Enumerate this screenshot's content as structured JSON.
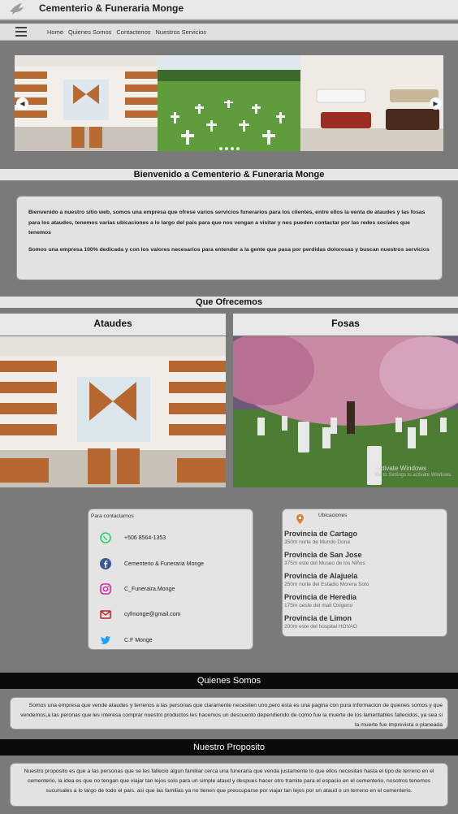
{
  "header": {
    "brand": "Cementerio & Funeraria Monge",
    "logo_icon": "dove-icon"
  },
  "nav": {
    "menu_icon": "hamburger-icon",
    "links": [
      "Home",
      "Quienes Somos",
      "Contactenos",
      "Nuestros Servicios"
    ]
  },
  "carousel": {
    "prev_icon": "chevron-left-icon",
    "next_icon": "chevron-right-icon",
    "slide_count": 4,
    "slides": [
      "coffin-showroom",
      "military-cemetery",
      "coffin-display"
    ]
  },
  "welcome": {
    "heading": "Bienvenido a Cementerio & Funeraria Monge",
    "paragraph1": "Bienvenido a nuestro sitio web, somos una empresa que ofrese varios servicios funerarios para los clientes, entre ellos la venta de ataudes y las fosas para los ataudes, tenemos varias ubicaciones a lo largo del pais para que nos vengan a visitar y nos pueden contactar por las redes sociales que tenemos",
    "paragraph2": "Somos una empresa 100% dedicada y con los valores necesarios para entender a la gente que pasa por perdidas dolorosas y buscan nuestros servicios"
  },
  "offer": {
    "heading": "Que Ofrecemos",
    "left_title": "Ataudes",
    "right_title": "Fosas"
  },
  "contact": {
    "title": "Para contactarnos",
    "items": [
      {
        "icon": "whatsapp-icon",
        "text": "+506 8564-1353",
        "color": "#25d366"
      },
      {
        "icon": "facebook-icon",
        "text": "Cementerio & Funeraria Monge",
        "color": "#3b5998"
      },
      {
        "icon": "instagram-icon",
        "text": "C_Funeraira.Monge",
        "color": "#d6249f"
      },
      {
        "icon": "mail-icon",
        "text": "cyfmonge@gmail.com",
        "color": "#c21f1f"
      },
      {
        "icon": "twitter-icon",
        "text": "C.F Monge",
        "color": "#1da1f2"
      }
    ]
  },
  "locations": {
    "title": "Ubicaciones",
    "icon": "map-pin-icon",
    "items": [
      {
        "name": "Provincia de Cartago",
        "address": "350m norte de Mundo Dona"
      },
      {
        "name": "Provincia de San Jose",
        "address": "375m este del Museo de los Niños"
      },
      {
        "name": "Provincia de Alajuela",
        "address": "250m norte del Estadio Morera Soto"
      },
      {
        "name": "Provincia de Heredia",
        "address": "175m oeste del mall Oxigeno"
      },
      {
        "name": "Provincia de Limon",
        "address": "200m este del hospital HOVAO"
      }
    ]
  },
  "about": {
    "heading": "Quienes Somos",
    "text": "Somos una empresa que vende ataudes y terrenos a las personas que claramente necesiten uno,pero esta es una pagina con pura informacion de quienes somos y que vendemos,a las peronas que les interesa comprar nuestro productos les hacemos un descuento dependiendo de como fue la muerte de los lamentables fallecidos, ya sea si la muerte fue imprevista o planeada"
  },
  "purpose": {
    "heading": "Nuestro Proposito",
    "text": "Nuestro proposito es que a las personas que se les fallecio algun familiar cerca una funeraria que venda justamente lo que ellos necesitan hasta el tipo de terreno en el cementerio, la idea es que no tengan que viajar tan lejos solo para un simple ataud y despues hacer otro tramite para el espacio en el cementerio, nosotros tenemos sucursales a lo largo de todo el pais. asi que las familias ya no tienen que preocuparse por viajar tan lejos por un ataud o un terreno en el cementerio."
  },
  "watermark": {
    "line1": "Activate Windows",
    "line2": "Go to Settings to activate Windows."
  }
}
